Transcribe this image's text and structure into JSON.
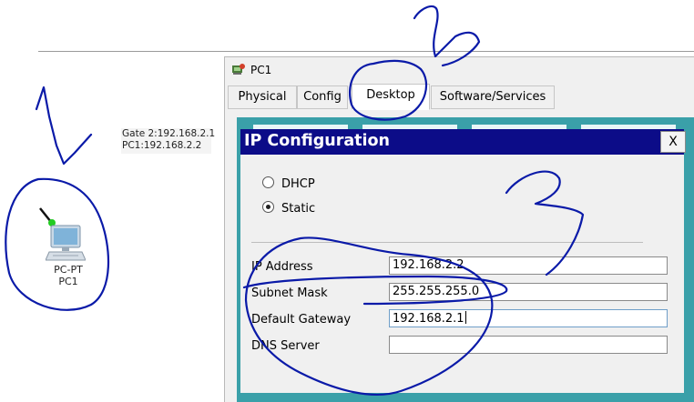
{
  "workspace": {
    "note_lines": [
      "Gate 2:192.168.2.1",
      "PC1:192.168.2.2"
    ],
    "device": {
      "type_label": "PC-PT",
      "name_label": "PC1",
      "icon": "pc-icon"
    }
  },
  "window": {
    "title": "PC1",
    "icon": "packet-tracer-icon",
    "tabs": [
      {
        "label": "Physical"
      },
      {
        "label": "Config"
      },
      {
        "label": "Desktop",
        "active": true
      },
      {
        "label": "Software/Services"
      }
    ]
  },
  "ip_config": {
    "title": "IP Configuration",
    "close_label": "X",
    "modes": [
      {
        "label": "DHCP",
        "checked": false
      },
      {
        "label": "Static",
        "checked": true
      }
    ],
    "fields": [
      {
        "label": "IP Address",
        "value": "192.168.2.2"
      },
      {
        "label": "Subnet Mask",
        "value": "255.255.255.0"
      },
      {
        "label": "Default Gateway",
        "value": "192.168.2.1",
        "focused": true
      },
      {
        "label": "DNS Server",
        "value": ""
      }
    ]
  },
  "annotations": {
    "numbers": [
      "1",
      "2",
      "3"
    ],
    "color": "#0a1aa8"
  },
  "colors": {
    "dialog_title_bg": "#0c0c88",
    "panel_bg": "#3aa0a9",
    "link_dot": "#22cc22"
  }
}
